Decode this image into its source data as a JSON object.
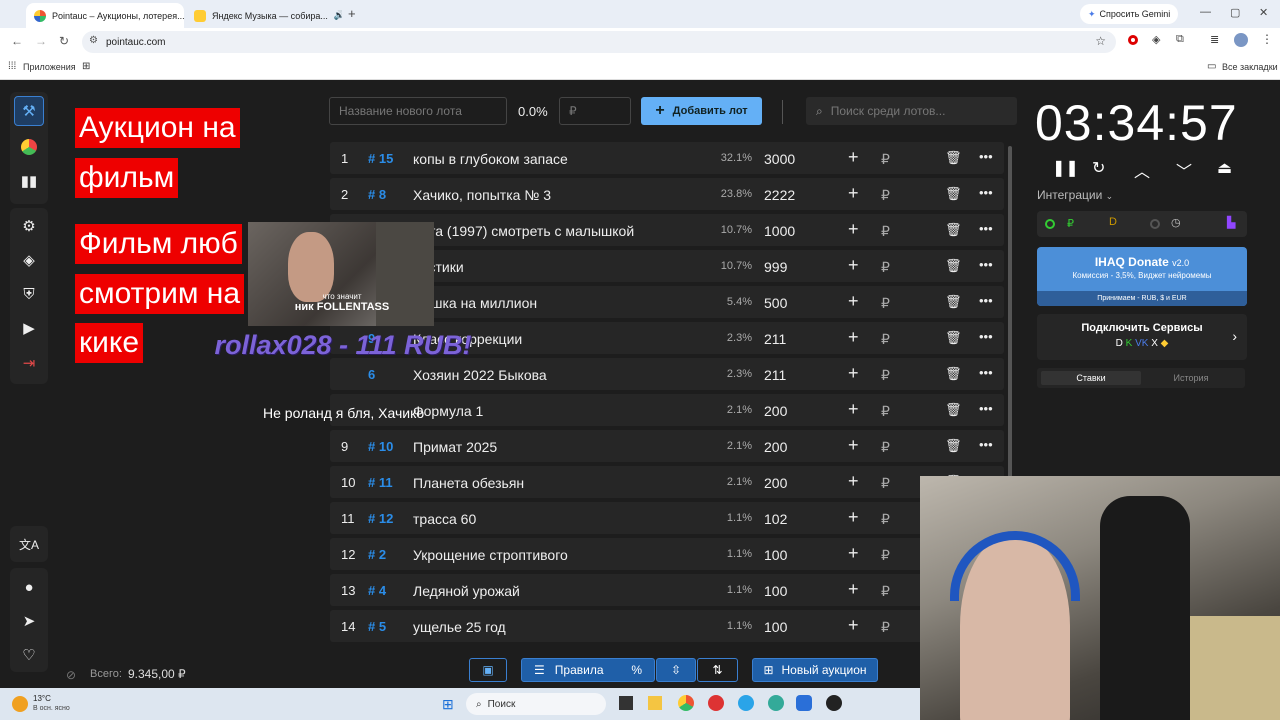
{
  "browser": {
    "tabs": [
      {
        "label": "Pointauc – Аукционы, лотерея..."
      },
      {
        "label": "Яндекс Музыка — собира..."
      }
    ],
    "gemini_label": "Спросить Gemini",
    "url": "pointauc.com",
    "bookmarks": {
      "apps": "Приложения",
      "all": "Все закладки"
    }
  },
  "overlay": {
    "title_lines": [
      "Аукцион на",
      "фильм"
    ],
    "subtitle_lines": [
      "Фильм люб",
      "смотрим на",
      "кике"
    ],
    "webcam_caption_line1": "что значит",
    "webcam_caption_line2": "ник FOLLENTASS",
    "donation_text": "rollax028 - 111 RUB!",
    "donation_message": "Не роланд я бля, Хачико"
  },
  "toolbar": {
    "new_lot_placeholder": "Название нового лота",
    "percent": "0.0%",
    "amount_placeholder": "₽",
    "add_lot_label": "Добавить лот",
    "search_placeholder": "Поиск среди лотов..."
  },
  "lots": [
    {
      "num": "1",
      "id": "# 15",
      "name": "копы в глубоком запасе",
      "pct": "32.1%",
      "amount": "3000"
    },
    {
      "num": "2",
      "id": "# 8",
      "name": "Хачико, попытка № 3",
      "pct": "23.8%",
      "amount": "2222"
    },
    {
      "num": "",
      "id": "",
      "name": "лита (1997) смотреть с малышкой",
      "pct": "10.7%",
      "amount": "1000"
    },
    {
      "num": "",
      "id": "",
      "name": "бастики",
      "pct": "10.7%",
      "amount": "999"
    },
    {
      "num": "",
      "id": "",
      "name": "лышка на миллион",
      "pct": "5.4%",
      "amount": "500"
    },
    {
      "num": "",
      "id": "9",
      "name": "Класс коррекции",
      "pct": "2.3%",
      "amount": "211"
    },
    {
      "num": "",
      "id": "6",
      "name": "Хозяин 2022 Быкова",
      "pct": "2.3%",
      "amount": "211"
    },
    {
      "num": "",
      "id": "",
      "name": "Формула 1",
      "pct": "2.1%",
      "amount": "200"
    },
    {
      "num": "9",
      "id": "# 10",
      "name": "Примат 2025",
      "pct": "2.1%",
      "amount": "200"
    },
    {
      "num": "10",
      "id": "# 11",
      "name": "Планета обезьян",
      "pct": "2.1%",
      "amount": "200"
    },
    {
      "num": "11",
      "id": "# 12",
      "name": "трасса 60",
      "pct": "1.1%",
      "amount": "102"
    },
    {
      "num": "12",
      "id": "# 2",
      "name": "Укрощение строптивого",
      "pct": "1.1%",
      "amount": "100"
    },
    {
      "num": "13",
      "id": "# 4",
      "name": "Ледяной урожай",
      "pct": "1.1%",
      "amount": "100"
    },
    {
      "num": "14",
      "id": "# 5",
      "name": "ущелье 25 год",
      "pct": "1.1%",
      "amount": "100"
    }
  ],
  "timer": "03:34:57",
  "right_panel": {
    "integrations": "Интеграции",
    "donate_title": "IHAQ Donate",
    "donate_version": "v2.0",
    "donate_line": "Комиссия - 3,5%, Виджет нейромемы",
    "donate_accept": "Принимаем - RUB, $ и EUR",
    "connect_label": "Подключить Сервисы",
    "tab_bets": "Ставки",
    "tab_history": "История"
  },
  "bottom": {
    "total_label": "Всего:",
    "total_value": "9.345,00 ₽",
    "rules_label": "Правила",
    "new_auction_label": "Новый аукцион"
  },
  "taskbar": {
    "weather_temp": "13°C",
    "weather_desc": "В осн. ясно",
    "search_label": "Поиск"
  }
}
